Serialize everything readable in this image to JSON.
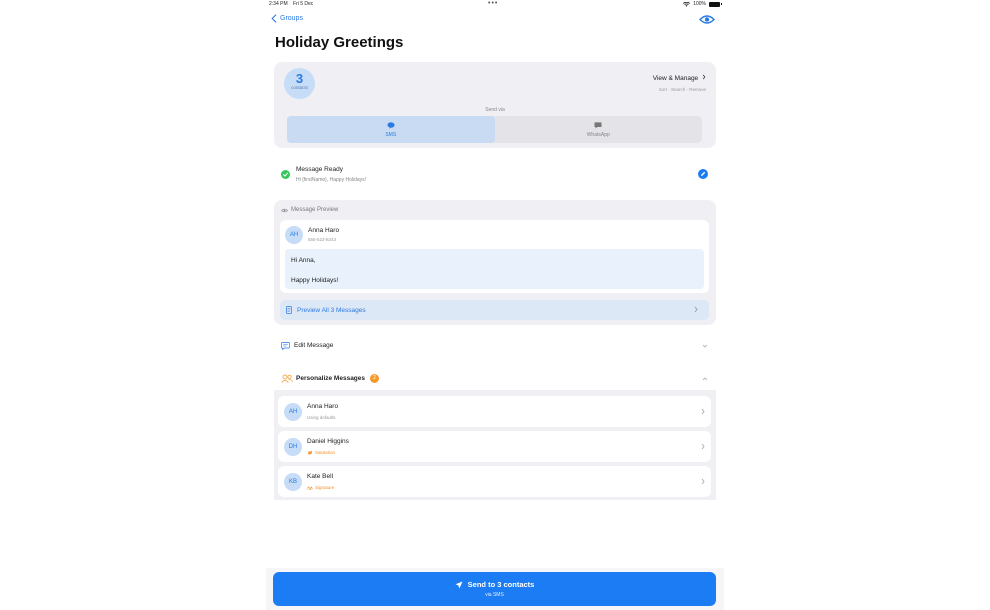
{
  "status_bar": {
    "time": "2:34 PM",
    "date": "Fri 5 Dec",
    "dots": "•••",
    "battery": "100%"
  },
  "nav": {
    "back_label": "Groups"
  },
  "page_title": "Holiday Greetings",
  "contacts_card": {
    "count": "3",
    "count_label": "contacts",
    "view_manage": "View & Manage",
    "view_manage_sub": "Sort · Search · Remove",
    "send_via": "Send via",
    "channels": [
      {
        "label": "SMS",
        "icon": "message-bubble-icon",
        "selected": true
      },
      {
        "label": "WhatsApp",
        "icon": "chat-bubble-icon",
        "selected": false
      }
    ]
  },
  "message_ready": {
    "title": "Message Ready",
    "subtitle": "Hi {firstName}, Happy Holidays!"
  },
  "preview": {
    "header": "Message Preview",
    "contact": {
      "initials": "AH",
      "name": "Anna Haro",
      "phone": "555-522-8243"
    },
    "message_lines": [
      "Hi Anna,",
      "",
      "Happy Holidays!"
    ],
    "preview_all_label": "Preview All 3 Messages"
  },
  "edit_message": {
    "label": "Edit Message"
  },
  "personalize": {
    "label": "Personalize Messages",
    "badge": "2",
    "items": [
      {
        "initials": "AH",
        "name": "Anna Haro",
        "sub": "Using defaults",
        "highlight": false
      },
      {
        "initials": "DH",
        "name": "Daniel Higgins",
        "sub": "Salutation",
        "highlight": true,
        "icon": "hand-wave-icon"
      },
      {
        "initials": "KB",
        "name": "Kate Bell",
        "sub": "Signature",
        "highlight": true,
        "icon": "signature-icon"
      }
    ]
  },
  "send": {
    "label": "Send to 3 contacts",
    "sub": "via SMS"
  },
  "colors": {
    "accent": "#1c7cf4",
    "success": "#34c759",
    "warning": "#f39a2b"
  }
}
